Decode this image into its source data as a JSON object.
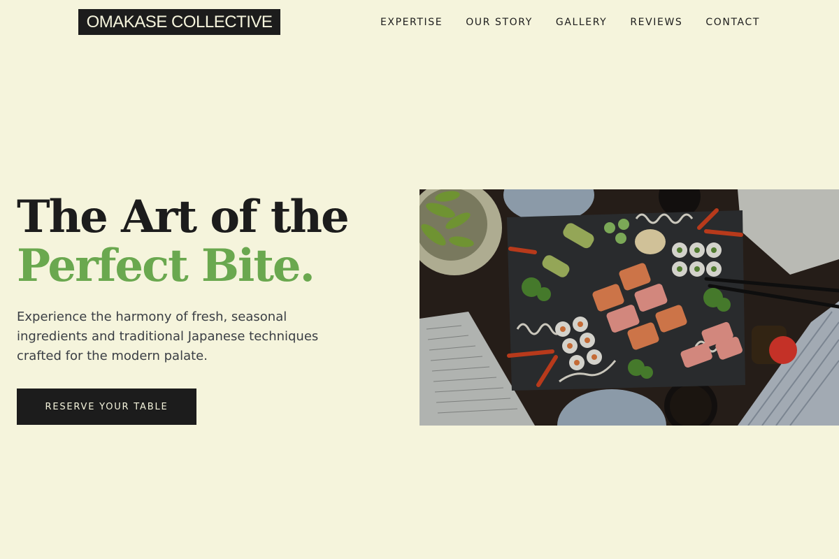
{
  "header": {
    "logo": "OMAKASE COLLECTIVE",
    "nav": [
      "EXPERTISE",
      "OUR STORY",
      "GALLERY",
      "REVIEWS",
      "CONTACT"
    ]
  },
  "hero": {
    "headline_line1": "The Art of the",
    "headline_line2": "Perfect Bite.",
    "lead": "Experience the harmony of fresh, seasonal ingredients and traditional Japanese techniques crafted for the modern palate.",
    "cta": "RESERVE YOUR TABLE",
    "image_alt": "Sushi platter on slate board"
  },
  "colors": {
    "background": "#f5f4dc",
    "dark": "#1c1c1c",
    "accent": "#6aa84f"
  }
}
